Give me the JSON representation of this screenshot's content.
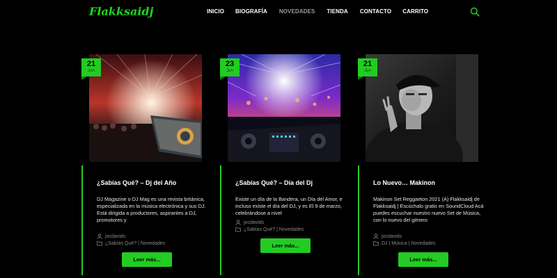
{
  "brand": {
    "logo_text": "Flakksaidj",
    "accent": "#22cc22"
  },
  "nav": {
    "items": [
      {
        "label": "INICIO"
      },
      {
        "label": "BIOGRAFÍA"
      },
      {
        "label": "NOVEDADES",
        "active": true
      },
      {
        "label": "TIENDA"
      },
      {
        "label": "CONTACTO"
      },
      {
        "label": "CARRITO"
      }
    ],
    "search_icon": "search-icon"
  },
  "posts": [
    {
      "day": "21",
      "month": "Jun",
      "title": "¿Sabías Qué? – Dj del Año",
      "excerpt": "DJ Magazine o DJ Mag es una revista británica, especializada en la música electrónica y sus DJ. Está dirigida a productores, aspirantes a DJ, promotores y",
      "author": "jocdavids",
      "categories": "¿Sabías Qué? | Novedades",
      "button": "Leer más..."
    },
    {
      "day": "23",
      "month": "Jun",
      "title": "¿Sabías Qué? – Día del Dj",
      "excerpt": "Existe un día de la Bandera, un Día del Amor, e incluso existe el día del DJ, y es El 9 de marzo, celebrándose a nivel",
      "author": "jocdavids",
      "categories": "¿Sabías Qué? | Novedades",
      "button": "Leer más..."
    },
    {
      "day": "21",
      "month": "Jun",
      "title": "Lo Nuevo… Makinon",
      "excerpt": "Makinon Set Reggaeton 2021 (A) Flakksaidj de Flakksaidj | Escúchalo gratis en SoundCloud Acá puedes escuchar nuestro nuevo Set de Música, con lo nuevo del género",
      "author": "jocdavids",
      "categories": "DJ | Música | Novedades",
      "button": "Leer más..."
    }
  ]
}
